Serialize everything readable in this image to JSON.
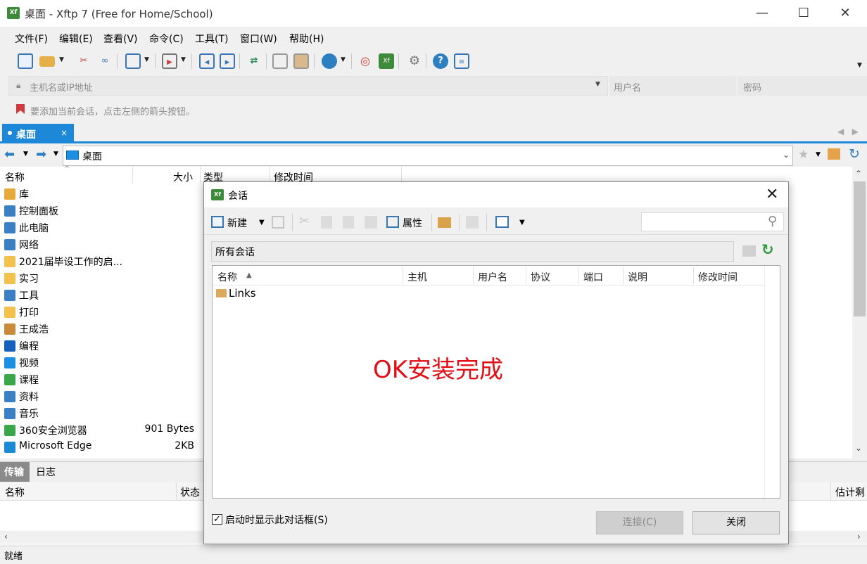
{
  "window": {
    "title": "桌面 - Xftp 7 (Free for Home/School)",
    "app_icon_text": "Xf",
    "min": "—",
    "max": "☐",
    "close": "✕"
  },
  "menu": [
    "文件(F)",
    "编辑(E)",
    "查看(V)",
    "命令(C)",
    "工具(T)",
    "窗口(W)",
    "帮助(H)"
  ],
  "connect": {
    "host_placeholder": "主机名或IP地址",
    "user_placeholder": "用户名",
    "password_placeholder": "密码"
  },
  "hint": "要添加当前会话，点击左侧的箭头按钮。",
  "tab": {
    "label": "桌面",
    "close": "×"
  },
  "path": {
    "current": "桌面"
  },
  "file_columns": {
    "name": "名称",
    "size": "大小",
    "type": "类型",
    "modified": "修改时间"
  },
  "files": [
    {
      "name": "库",
      "size": "",
      "icon": "library-icon",
      "color": "#e6a93a"
    },
    {
      "name": "控制面板",
      "size": "",
      "icon": "control-panel-icon",
      "color": "#3b7fc4"
    },
    {
      "name": "此电脑",
      "size": "",
      "icon": "computer-icon",
      "color": "#3b7fc4"
    },
    {
      "name": "网络",
      "size": "",
      "icon": "network-icon",
      "color": "#3b7fc4"
    },
    {
      "name": "2021届毕设工作的启...",
      "size": "",
      "icon": "folder-icon",
      "color": "#f2c14e"
    },
    {
      "name": "实习",
      "size": "",
      "icon": "folder-icon",
      "color": "#f2c14e"
    },
    {
      "name": "工具",
      "size": "",
      "icon": "tools-icon",
      "color": "#3b7fc4"
    },
    {
      "name": "打印",
      "size": "",
      "icon": "folder-icon",
      "color": "#f2c14e"
    },
    {
      "name": "王成浩",
      "size": "",
      "icon": "user-icon",
      "color": "#c98a3a"
    },
    {
      "name": "编程",
      "size": "",
      "icon": "help-icon",
      "color": "#1560bd"
    },
    {
      "name": "视频",
      "size": "",
      "icon": "monitor-icon",
      "color": "#1c8fe0"
    },
    {
      "name": "课程",
      "size": "",
      "icon": "upload-folder-icon",
      "color": "#3aa84a"
    },
    {
      "name": "资料",
      "size": "",
      "icon": "play-icon",
      "color": "#3b7fc4"
    },
    {
      "name": "音乐",
      "size": "",
      "icon": "globe-icon",
      "color": "#3b7fc4"
    },
    {
      "name": "360安全浏览器",
      "size": "901 Bytes",
      "icon": "browser-icon",
      "color": "#3aa84a"
    },
    {
      "name": "Microsoft Edge",
      "size": "2KB",
      "icon": "edge-icon",
      "color": "#1b8ad3"
    }
  ],
  "bottom_tabs": {
    "transfer": "传输",
    "log": "日志"
  },
  "transfer_columns": {
    "name": "名称",
    "status": "状态",
    "eta": "估计剩"
  },
  "status": "就绪",
  "dialog": {
    "title": "会话",
    "close": "✕",
    "toolbar": {
      "new": "新建",
      "properties": "属性"
    },
    "path": "所有会话",
    "columns": {
      "name": "名称",
      "host": "主机",
      "user": "用户名",
      "protocol": "协议",
      "port": "端口",
      "description": "说明",
      "modified": "修改时间"
    },
    "items": [
      {
        "name": "Links"
      }
    ],
    "overlay_text": "OK安装完成",
    "startup_checkbox": "启动时显示此对话框(S)",
    "connect_button": "连接(C)",
    "close_button": "关闭"
  },
  "colors": {
    "accent": "#1e88d8",
    "overlay": "#e10f16",
    "brand_green": "#3c8a3a"
  }
}
